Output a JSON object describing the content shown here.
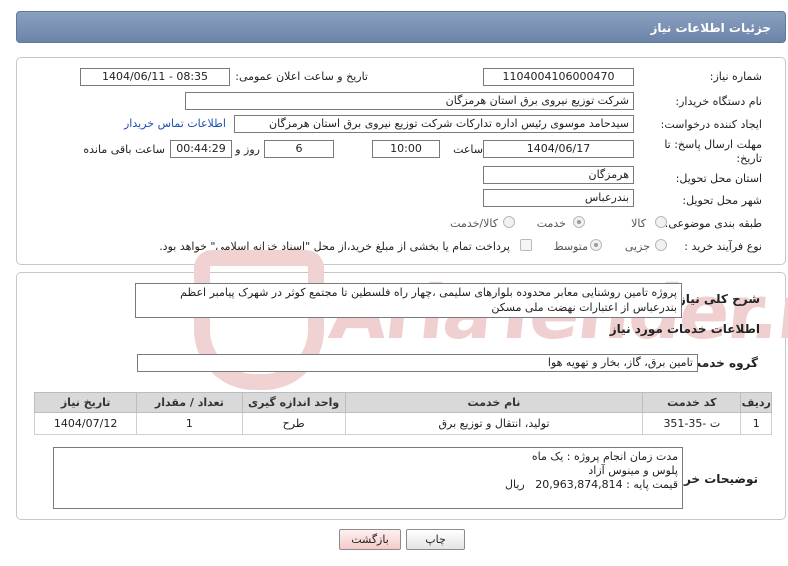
{
  "header": {
    "title": "جزئیات اطلاعات نیاز"
  },
  "watermark": {
    "text": "AriaTender.neT"
  },
  "form": {
    "need_number_label": "شماره نیاز:",
    "need_number": "1104004106000470",
    "announce_label": "تاریخ و ساعت اعلان عمومی:",
    "announce_value": "1404/06/11 - 08:35",
    "buyer_org_label": "نام دستگاه خریدار:",
    "buyer_org": "شرکت توزیع نیروی برق استان هرمزگان",
    "requester_label": "ایجاد کننده درخواست:",
    "requester": "سیدحامد موسوی رئیس اداره تدارکات شرکت توزیع نیروی برق استان هرمزگان",
    "contact_link": "اطلاعات تماس خریدار",
    "deadline_label_1": "مهلت ارسال پاسخ: تا",
    "deadline_label_2": "تاریخ:",
    "deadline_date": "1404/06/17",
    "time_label": "ساعت",
    "deadline_time": "10:00",
    "days_value": "6",
    "days_label": "روز و",
    "remaining_time": "00:44:29",
    "remaining_label": "ساعت باقی مانده",
    "province_label": "استان محل تحویل:",
    "province": "هرمزگان",
    "city_label": "شهر محل تحویل:",
    "city": "بندرعباس",
    "category_label": "طبقه بندی موضوعی:",
    "category_options": [
      "کالا",
      "خدمت",
      "کالا/خدمت"
    ],
    "category_selected": "خدمت",
    "purchase_type_label": "نوع فرآیند خرید :",
    "purchase_options": [
      "جزیی",
      "متوسط"
    ],
    "purchase_selected": "متوسط",
    "payment_note": "پرداخت تمام یا بخشی از مبلغ خرید،از محل \"اسناد خزانه اسلامی\" خواهد بود."
  },
  "description": {
    "label": "شرح کلی نیاز:",
    "text_line1": "پروژه تامین  روشنایی معابر محدوده  بلوارهای سلیمی ،چهار راه فلسطین تا مجتمع کوثر در شهرک پیامبر اعظم",
    "text_line2": "بندرعباس از اعتبارات نهضت ملی مسکن"
  },
  "services": {
    "section_title": "اطلاعات خدمات مورد نیاز",
    "group_label": "گروه خدمت:",
    "group_value": "تامین برق، گاز، بخار و تهویه هوا",
    "columns": [
      "ردیف",
      "کد خدمت",
      "نام خدمت",
      "واحد اندازه گیری",
      "تعداد / مقدار",
      "تاریخ نیاز"
    ],
    "rows": [
      {
        "row": "1",
        "code": "ت -35-351",
        "name": "تولید، انتقال و توزیع برق",
        "unit": "طرح",
        "qty": "1",
        "date": "1404/07/12"
      }
    ]
  },
  "buyer_notes": {
    "label": "توضیحات خریدار:",
    "line1": "مدت زمان انجام پروژه : یک ماه",
    "line2": "پلوس و مینوس آزاد",
    "line3_prefix": "قیمت پایه : ",
    "line3_amount": "20,963,874,814",
    "line3_unit": "ریال"
  },
  "buttons": {
    "print": "چاپ",
    "back": "بازگشت"
  },
  "colors": {
    "header": "#6b84a8",
    "link": "#1a4fb0",
    "watermark": "#e9c4c4"
  }
}
